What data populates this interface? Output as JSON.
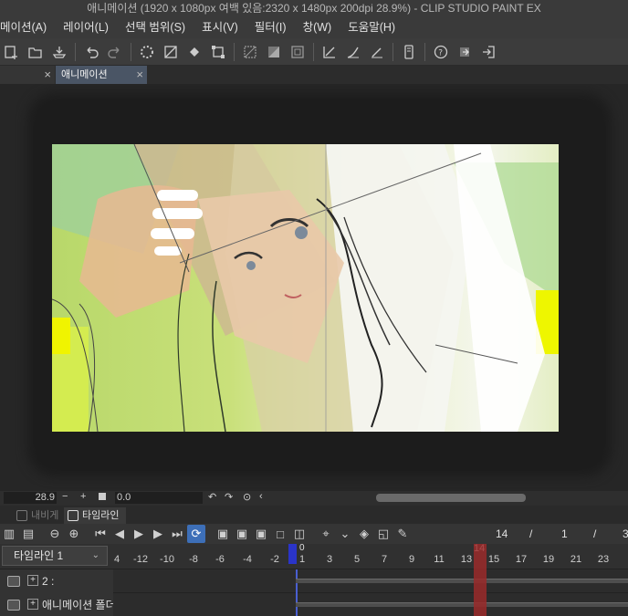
{
  "window": {
    "title": "애니메이션 (1920 x 1080px 여백 있음:2320 x 1480px 200dpi 28.9%)  - CLIP STUDIO PAINT EX"
  },
  "menu": {
    "items": [
      "메이션(A)",
      "레이어(L)",
      "선택 범위(S)",
      "표시(V)",
      "필터(I)",
      "창(W)",
      "도움말(H)"
    ]
  },
  "toolbar": {
    "icons": [
      "new-icon",
      "open-icon",
      "save-icon",
      "undo-icon",
      "redo-icon",
      "loading-icon",
      "clear-icon",
      "fill-icon",
      "transform-icon",
      "select-none-icon",
      "select-invert-icon",
      "select-border-icon",
      "ruler-icon",
      "pen-icon",
      "pen2-icon",
      "device-icon",
      "help-icon",
      "share-icon",
      "exit-icon"
    ]
  },
  "tabs": [
    {
      "label": ""
    },
    {
      "label": "애니메이션"
    }
  ],
  "status": {
    "zoom": "28.9",
    "rotation": "0.0"
  },
  "panel_tabs": {
    "navigator": "내비게이터",
    "timeline": "타임라인"
  },
  "timeline_toolbar": {
    "current_frame": "14",
    "slash1": "/",
    "value2": "1",
    "slash2": "/",
    "value3": "3"
  },
  "timeline": {
    "name": "타임라인 1",
    "start_label": "0",
    "current_label": "14",
    "ruler_labels": [
      "4",
      "-12",
      "-10",
      "-8",
      "-6",
      "-4",
      "-2",
      "1",
      "3",
      "5",
      "7",
      "9",
      "11",
      "13",
      "15",
      "17",
      "19",
      "21",
      "23"
    ],
    "tracks": [
      {
        "label": "2 :"
      },
      {
        "label": "애니메이션 폴더 :"
      }
    ]
  },
  "colors": {
    "accent": "#3d6fb8",
    "current_frame": "#9a2a2a",
    "start_marker": "#2a34c8"
  }
}
